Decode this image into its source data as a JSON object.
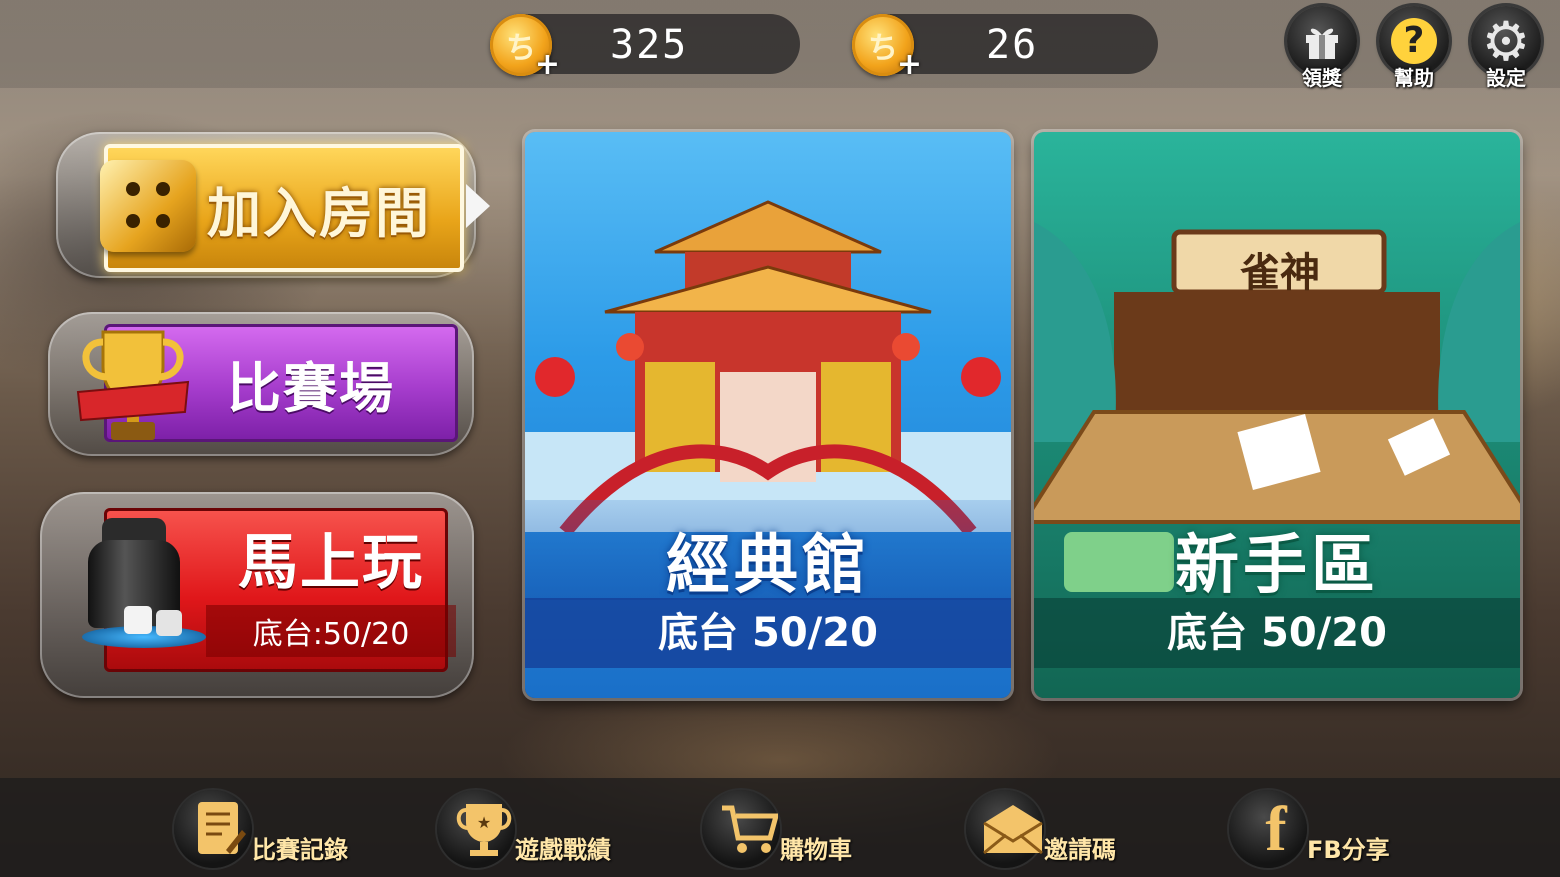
{
  "currency": {
    "gold_coins": "325",
    "gems": "26"
  },
  "top_actions": [
    {
      "label": "領獎",
      "icon": "gift-icon"
    },
    {
      "label": "幫助",
      "icon": "question-icon"
    },
    {
      "label": "設定",
      "icon": "gear-icon"
    }
  ],
  "left_menu": {
    "join_room": "加入房間",
    "tournament": "比賽場",
    "quick_play": "馬上玩",
    "quick_play_stake": "底台:50/20"
  },
  "rooms": [
    {
      "title": "經典館",
      "stake": "底台  50/20",
      "theme_color": "#2f7fe0"
    },
    {
      "title": "新手區",
      "stake": "底台  50/20",
      "theme_color": "#1f9a83",
      "sign": "雀神"
    }
  ],
  "bottom_nav": [
    {
      "label": "比賽記錄",
      "icon": "record-icon"
    },
    {
      "label": "遊戲戰績",
      "icon": "trophy-icon"
    },
    {
      "label": "購物車",
      "icon": "cart-icon"
    },
    {
      "label": "邀請碼",
      "icon": "envelope-icon"
    },
    {
      "label": "FB分享",
      "icon": "facebook-icon"
    }
  ]
}
